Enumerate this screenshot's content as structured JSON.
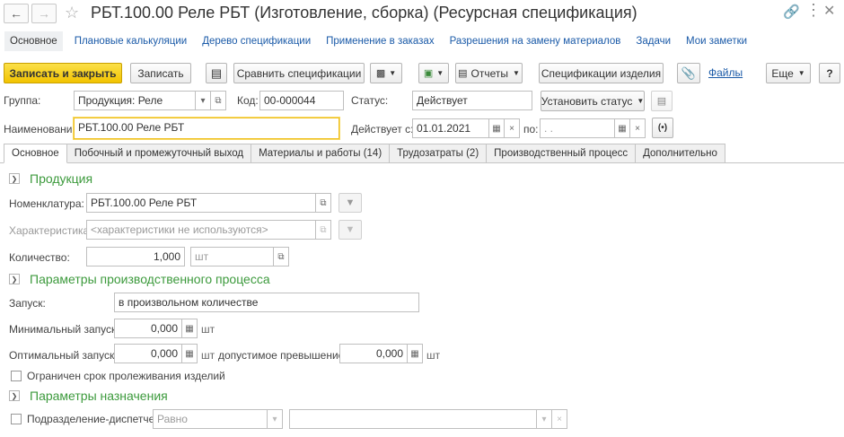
{
  "window": {
    "title": "РБТ.100.00 Реле РБТ (Изготовление, сборка) (Ресурсная спецификация)"
  },
  "nav_links": [
    "Основное",
    "Плановые калькуляции",
    "Дерево спецификации",
    "Применение в заказах",
    "Разрешения на замену материалов",
    "Задачи",
    "Мои заметки"
  ],
  "toolbar": {
    "save_close": "Записать и закрыть",
    "save": "Записать",
    "compare": "Сравнить спецификации",
    "reports": "Отчеты",
    "item_specs": "Спецификации изделия",
    "files": "Файлы",
    "more": "Еще",
    "help": "?"
  },
  "header": {
    "group_label": "Группа:",
    "group_value": "Продукция: Реле",
    "code_label": "Код:",
    "code_value": "00-000044",
    "status_label": "Статус:",
    "status_value": "Действует",
    "set_status": "Установить статус",
    "name_label": "Наименование:",
    "name_value": "РБТ.100.00 Реле РБТ",
    "valid_from_label": "Действует с:",
    "valid_from_value": "01.01.2021",
    "valid_to_label": "по:",
    "valid_to_value": " .  ."
  },
  "tabs": [
    "Основное",
    "Побочный и промежуточный выход",
    "Материалы и работы (14)",
    "Трудозатраты (2)",
    "Производственный процесс",
    "Дополнительно"
  ],
  "product": {
    "section": "Продукция",
    "nomenclature_label": "Номенклатура:",
    "nomenclature_value": "РБТ.100.00 Реле РБТ",
    "characteristic_label": "Характеристика:",
    "characteristic_placeholder": "<характеристики не используются>",
    "quantity_label": "Количество:",
    "quantity_value": "1,000",
    "quantity_unit": "шт"
  },
  "process": {
    "section": "Параметры производственного процесса",
    "launch_label": "Запуск:",
    "launch_value": "в произвольном количестве",
    "min_label": "Минимальный запуск:",
    "min_value": "0,000",
    "min_unit": "шт",
    "opt_label": "Оптимальный запуск:",
    "opt_value": "0,000",
    "opt_unit": "шт",
    "excess_label": "допустимое превышение:",
    "excess_value": "0,000",
    "excess_unit": "шт",
    "shelf_life_label": "Ограничен срок пролеживания изделий"
  },
  "assignment": {
    "section": "Параметры назначения",
    "dispatcher_label": "Подразделение-диспетчер",
    "condition_value": "Равно"
  }
}
